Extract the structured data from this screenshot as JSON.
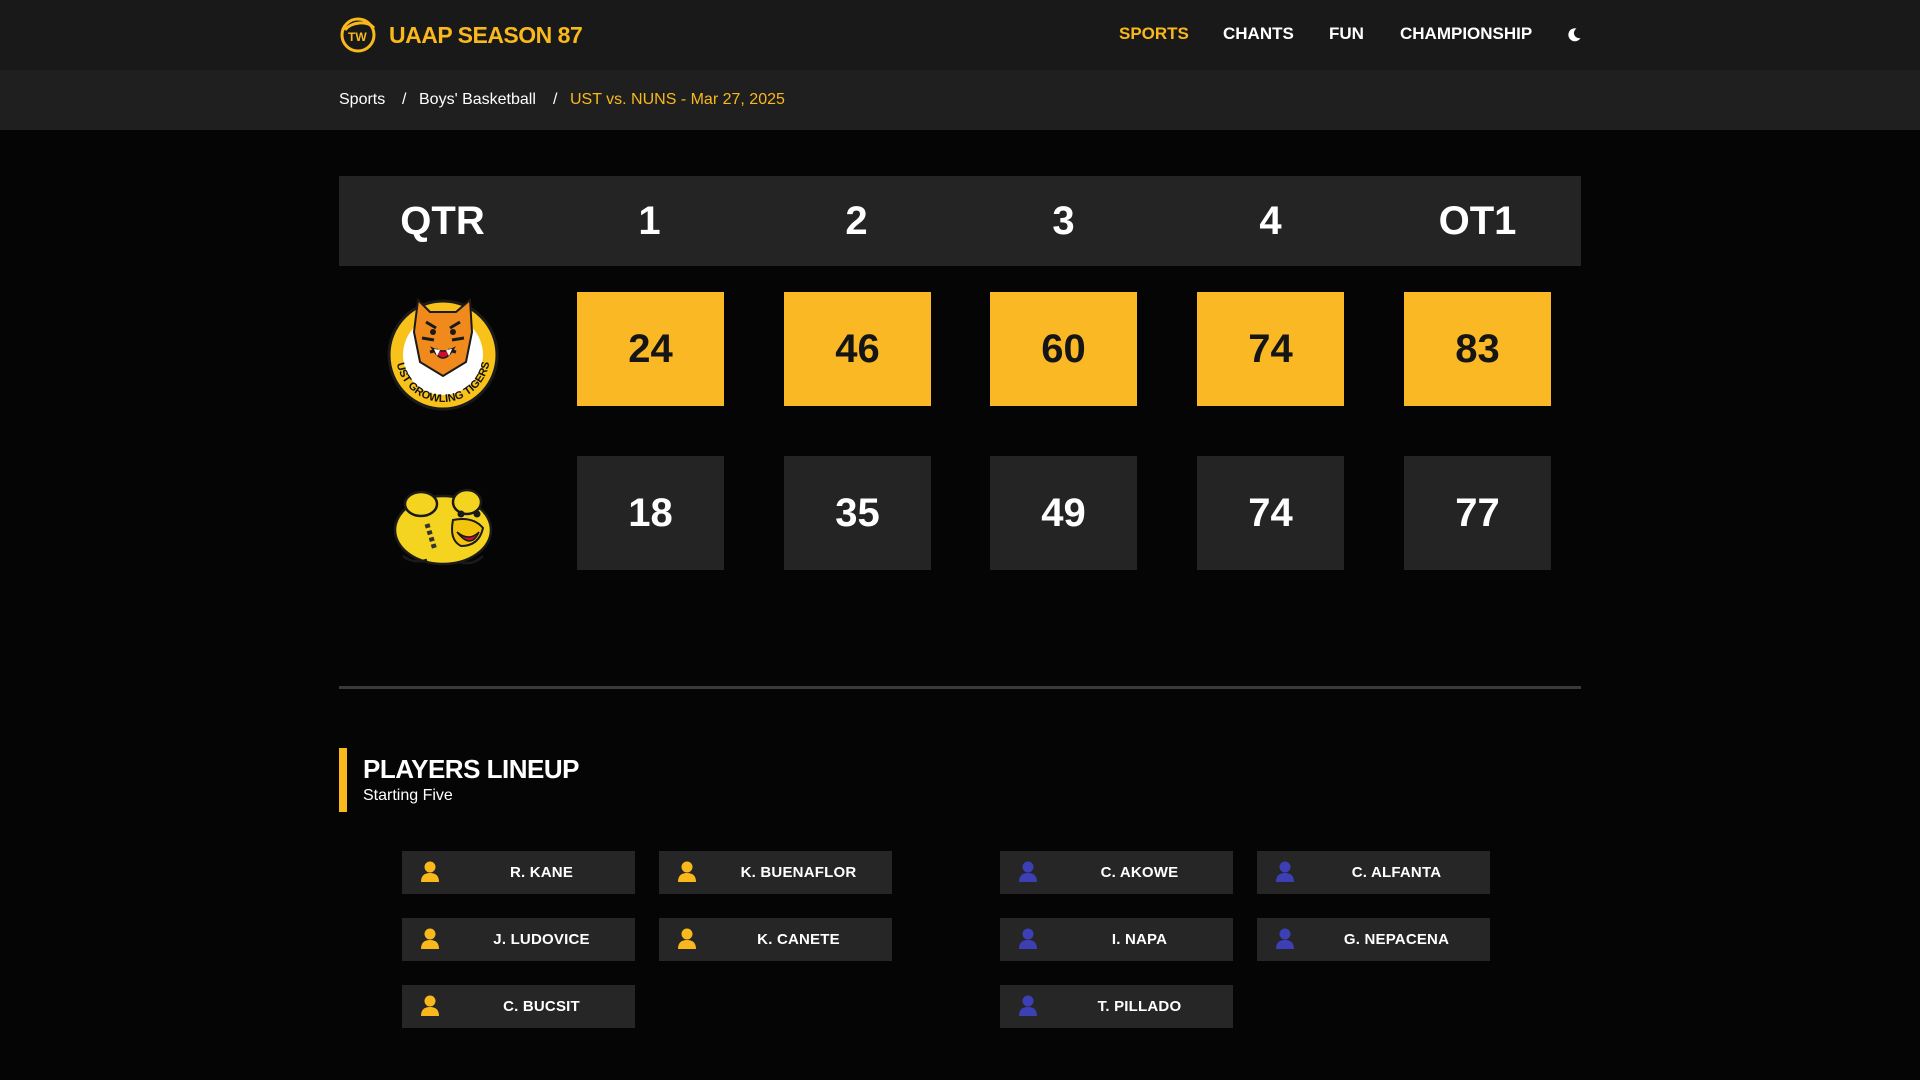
{
  "header": {
    "brand_title": "UAAP SEASON 87",
    "nav": [
      "SPORTS",
      "CHANTS",
      "FUN",
      "CHAMPIONSHIP"
    ],
    "active_nav": "SPORTS",
    "theme_toggle_icon": "moon-icon"
  },
  "breadcrumb": {
    "items": [
      "Sports",
      "Boys' Basketball"
    ],
    "separator": "/",
    "current": "UST vs. NUNS - Mar 27, 2025"
  },
  "scoreboard": {
    "header_label": "QTR",
    "periods": [
      "1",
      "2",
      "3",
      "4",
      "OT1"
    ],
    "teams": [
      {
        "logo": "ust-growling-tigers-logo",
        "logo_text": "UST GROWLING TIGERS",
        "scores": [
          "24",
          "46",
          "60",
          "74",
          "83"
        ],
        "highlight": true
      },
      {
        "logo": "nu-bulldog-logo",
        "scores": [
          "18",
          "35",
          "49",
          "74",
          "77"
        ],
        "highlight": false
      }
    ]
  },
  "lineup": {
    "title": "PLAYERS LINEUP",
    "subtitle": "Starting Five",
    "team_a": {
      "icon": "user-icon",
      "icon_color": "#f9b91c",
      "players": [
        "R. KANE",
        "K. BUENAFLOR",
        "J. LUDOVICE",
        "K. CANETE",
        "C. BUCSIT"
      ]
    },
    "team_b": {
      "icon": "user-icon",
      "icon_color": "#3d3fb4",
      "players": [
        "C. AKOWE",
        "C. ALFANTA",
        "I. NAPA",
        "G. NEPACENA",
        "T. PILLADO"
      ]
    }
  },
  "colors": {
    "accent": "#f9b91c",
    "score_highlight": "#fbb825",
    "background": "#050505",
    "panel": "#242424"
  }
}
